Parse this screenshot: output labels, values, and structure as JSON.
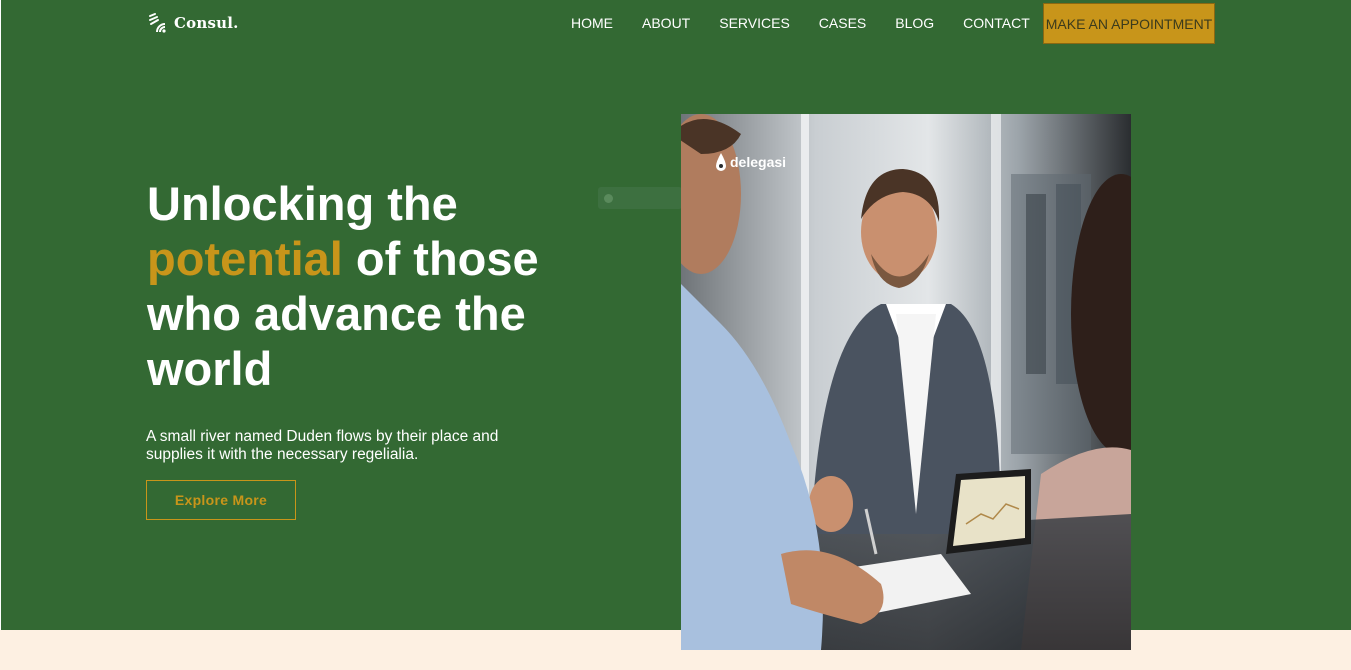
{
  "brand": {
    "name": "Consul.",
    "icon": "wifi-signal-icon"
  },
  "nav": {
    "items": [
      {
        "label": "HOME"
      },
      {
        "label": "ABOUT"
      },
      {
        "label": "SERVICES"
      },
      {
        "label": "CASES"
      },
      {
        "label": "BLOG"
      },
      {
        "label": "CONTACT"
      }
    ],
    "cta_label": "MAKE AN APPOINTMENT"
  },
  "hero": {
    "headline_part1": "Unlocking the",
    "headline_accent": "potential",
    "headline_part2": " of those who advance the world",
    "subtext": "A small river named Duden flows by their place and supplies it with the necessary regelialia.",
    "button_label": "Explore More",
    "photo_logo": "delegasi",
    "photo_logo_icon": "droplet-logo-icon"
  },
  "colors": {
    "hero_bg": "#336933",
    "accent": "#c8951a",
    "band": "#fdf0e2"
  }
}
